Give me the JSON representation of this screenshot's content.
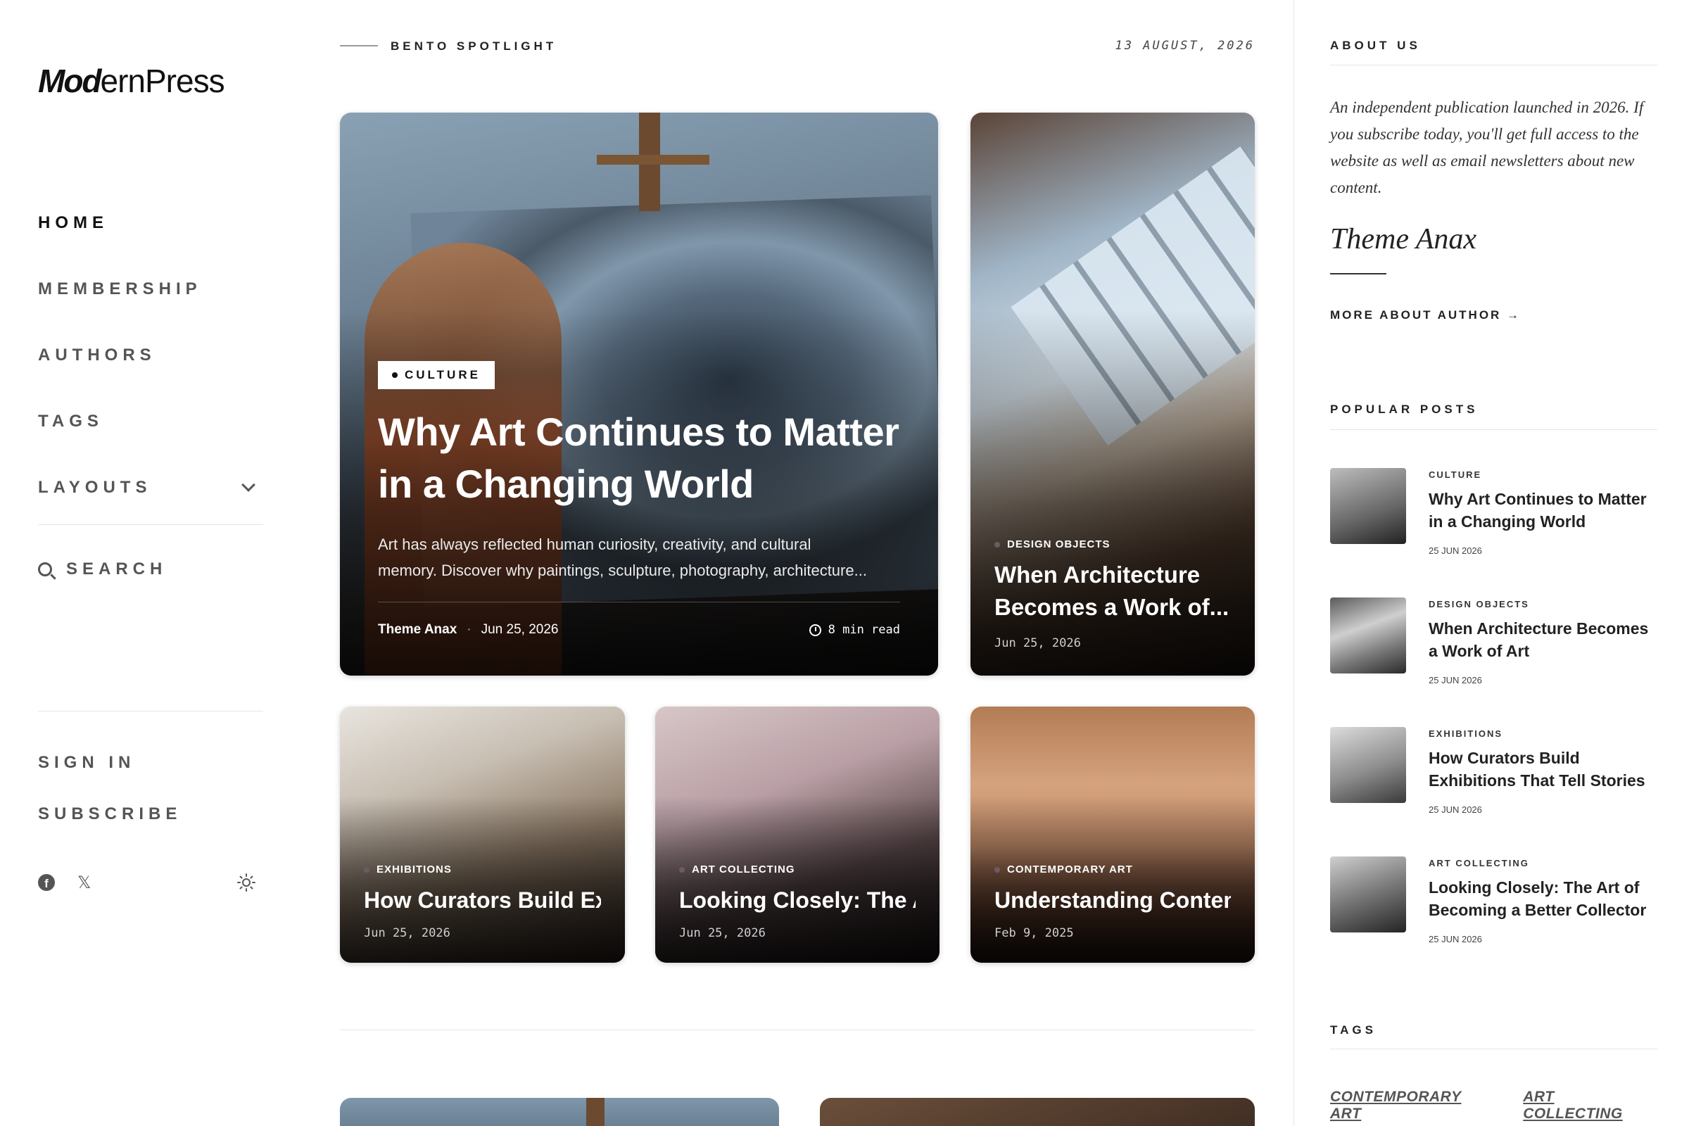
{
  "logo": {
    "bold": "Mod",
    "rest": "ernPress"
  },
  "nav": {
    "items": [
      {
        "label": "HOME"
      },
      {
        "label": "MEMBERSHIP"
      },
      {
        "label": "AUTHORS"
      },
      {
        "label": "TAGS"
      },
      {
        "label": "LAYOUTS"
      }
    ],
    "search_label": "SEARCH",
    "sign_in": "SIGN IN",
    "subscribe": "SUBSCRIBE",
    "social_icons": [
      "facebook-icon",
      "x-icon",
      "theme-toggle-sun-icon"
    ],
    "facebook_glyph": "f",
    "x_glyph": "𝕏"
  },
  "spotlight": {
    "label": "BENTO SPOTLIGHT",
    "date": "13 AUGUST, 2026"
  },
  "main_post": {
    "category": "CULTURE",
    "title": "Why Art Continues to Matter in a Changing World",
    "excerpt_line1": "Art has always reflected human curiosity, creativity, and cultural",
    "excerpt_line2": "memory. Discover why paintings, sculpture, photography, architecture...",
    "author": "Theme Anax",
    "sep": "·",
    "date": "Jun 25, 2026",
    "read_time": "8 min read"
  },
  "side_post": {
    "category": "DESIGN OBJECTS",
    "title": "When Architecture Becomes a Work of...",
    "date": "Jun 25, 2026"
  },
  "bottom_posts": [
    {
      "category": "EXHIBITIONS",
      "title": "How Curators Build Exhibitions That Tel...",
      "date": "Jun 25, 2026"
    },
    {
      "category": "ART COLLECTING",
      "title": "Looking Closely: The Art of Becoming a...",
      "date": "Jun 25, 2026"
    },
    {
      "category": "CONTEMPORARY ART",
      "title": "Understanding Contemporary Art: ...",
      "date": "Feb 9, 2025"
    }
  ],
  "about": {
    "heading": "ABOUT US",
    "text": "An independent publication launched in 2026. If you subscribe today, you'll get full access to the website as well as email newsletters about new content.",
    "signature": "Theme Anax",
    "more_label": "MORE ABOUT AUTHOR →"
  },
  "popular": {
    "heading": "POPULAR POSTS",
    "items": [
      {
        "category": "CULTURE",
        "title": "Why Art Continues to Matter in a Changing World",
        "date": "25 JUN 2026"
      },
      {
        "category": "DESIGN OBJECTS",
        "title": "When Architecture Becomes a Work of Art",
        "date": "25 JUN 2026"
      },
      {
        "category": "EXHIBITIONS",
        "title": "How Curators Build Exhibitions That Tell Stories",
        "date": "25 JUN 2026"
      },
      {
        "category": "ART COLLECTING",
        "title": "Looking Closely: The Art of Becoming a Better Collector",
        "date": "25 JUN 2026"
      }
    ]
  },
  "tags": {
    "heading": "TAGS",
    "items": [
      "CONTEMPORARY ART",
      "ART COLLECTING"
    ]
  }
}
